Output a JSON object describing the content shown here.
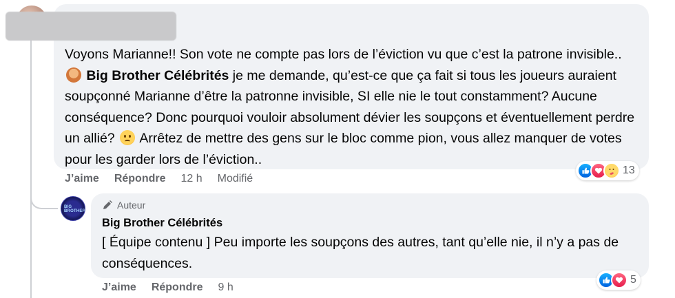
{
  "comment1": {
    "text_before_mention": "Voyons Marianne!! Son vote ne compte pas lors de l’éviction vu que c’est la patrone invisible.. ",
    "mention": "Big Brother Célébrités",
    "text_after_mention": " je me demande, qu’est-ce que ça fait si tous les joueurs auraient soupçonné Marianne d’être la patronne invisible, SI elle nie le tout constamment? Aucune conséquence? Donc pourquoi vouloir absolument dévier les soupçons et éventuellement perdre un allié? ",
    "text_end": " Arrêtez de mettre des gens sur le bloc comme pion, vous allez manquer de votes pour les garder lors de l’éviction..",
    "emoji1": "person-tipping-hand-emoji",
    "emoji2": "confused-face-emoji",
    "actions": {
      "like": "J’aime",
      "reply": "Répondre",
      "time": "12 h",
      "edited": "Modifié"
    },
    "reactions": {
      "icons": [
        "like",
        "love",
        "care"
      ],
      "count": "13"
    }
  },
  "comment2": {
    "badge": "Auteur",
    "name": "Big Brother Célébrités",
    "text": "[ Équipe contenu ] Peu importe les soupçons des autres, tant qu’elle nie, il n’y a pas de conséquences.",
    "actions": {
      "like": "J’aime",
      "reply": "Répondre",
      "time": "9 h"
    },
    "reactions": {
      "icons": [
        "like",
        "love"
      ],
      "count": "5"
    }
  },
  "colors": {
    "bubble": "#f0f2f5",
    "meta": "#65676b",
    "like": "#0866ff",
    "love": "#e61e4d"
  }
}
